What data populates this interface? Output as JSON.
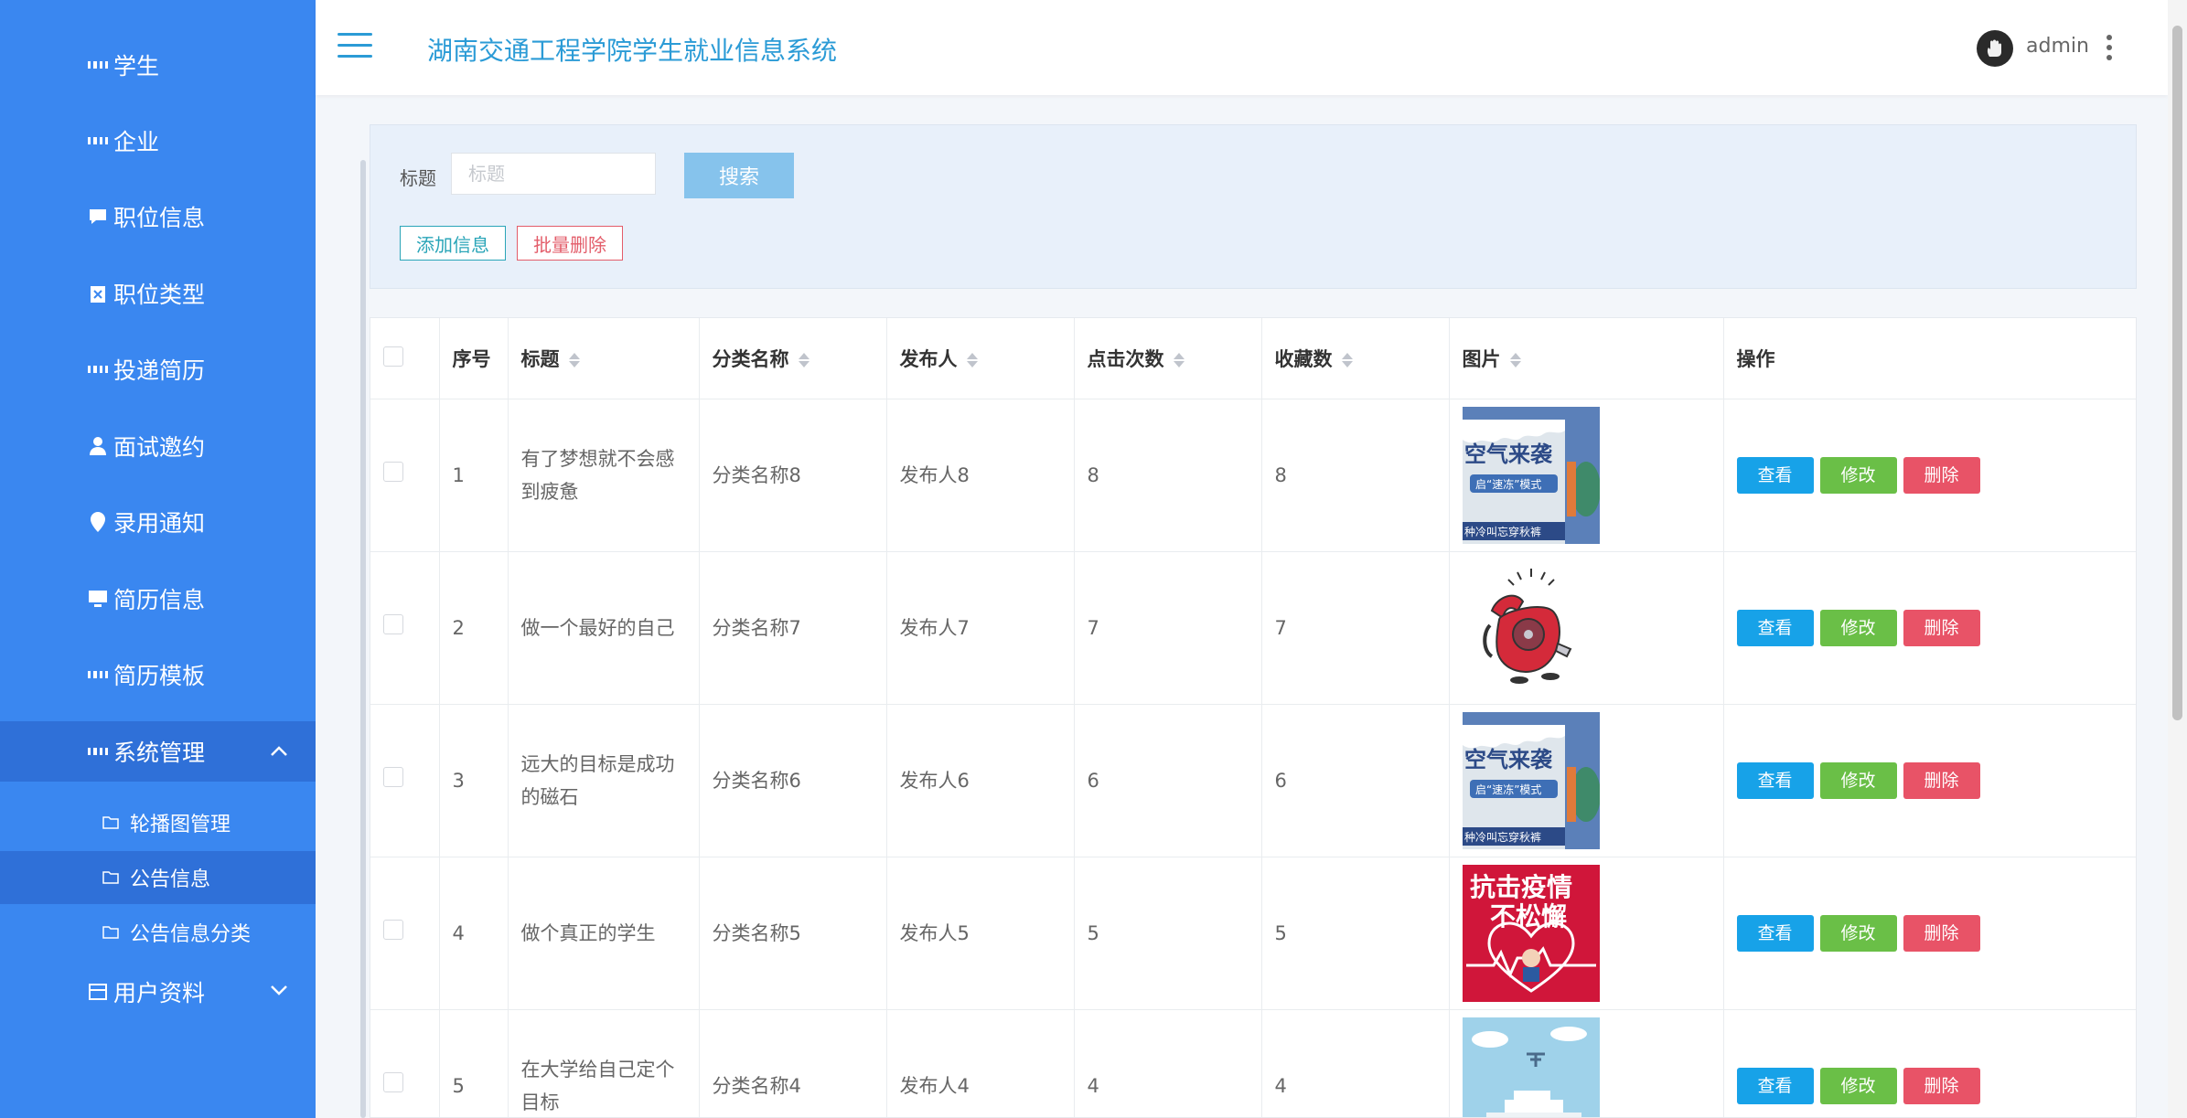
{
  "app": {
    "title": "湖南交通工程学院学生就业信息系统"
  },
  "user": {
    "name": "admin"
  },
  "sidebar": {
    "items": [
      {
        "label": "学生",
        "icon": "grid-icon"
      },
      {
        "label": "企业",
        "icon": "grid-icon"
      },
      {
        "label": "职位信息",
        "icon": "comment-icon"
      },
      {
        "label": "职位类型",
        "icon": "clipboard-icon"
      },
      {
        "label": "投递简历",
        "icon": "grid-icon"
      },
      {
        "label": "面试邀约",
        "icon": "user-icon"
      },
      {
        "label": "录用通知",
        "icon": "map-pin-icon"
      },
      {
        "label": "简历信息",
        "icon": "monitor-icon"
      },
      {
        "label": "简历模板",
        "icon": "grid-icon"
      },
      {
        "label": "系统管理",
        "icon": "grid-icon"
      }
    ],
    "sub_items": [
      {
        "label": "轮播图管理",
        "icon": "folder-icon"
      },
      {
        "label": "公告信息",
        "icon": "folder-icon"
      },
      {
        "label": "公告信息分类",
        "icon": "folder-icon"
      }
    ],
    "last_item": {
      "label": "用户资料",
      "icon": "card-icon"
    }
  },
  "search": {
    "label": "标题",
    "placeholder": "标题",
    "button": "搜索"
  },
  "toolbar": {
    "add_label": "添加信息",
    "batch_delete_label": "批量删除"
  },
  "table": {
    "headers": [
      "序号",
      "标题",
      "分类名称",
      "发布人",
      "点击次数",
      "收藏数",
      "图片",
      "操作"
    ],
    "actions": {
      "view": "查看",
      "edit": "修改",
      "delete": "删除"
    },
    "rows": [
      {
        "no": "1",
        "title": "有了梦想就不会感到疲惫",
        "category": "分类名称8",
        "publisher": "发布人8",
        "clicks": "8",
        "favorites": "8",
        "image": "cold-air-poster"
      },
      {
        "no": "2",
        "title": "做一个最好的自己",
        "category": "分类名称7",
        "publisher": "发布人7",
        "clicks": "7",
        "favorites": "7",
        "image": "red-telephone"
      },
      {
        "no": "3",
        "title": "远大的目标是成功的磁石",
        "category": "分类名称6",
        "publisher": "发布人6",
        "clicks": "6",
        "favorites": "6",
        "image": "cold-air-poster"
      },
      {
        "no": "4",
        "title": "做个真正的学生",
        "category": "分类名称5",
        "publisher": "发布人5",
        "clicks": "5",
        "favorites": "5",
        "image": "fight-epidemic-poster"
      },
      {
        "no": "5",
        "title": "在大学给自己定个目标",
        "category": "分类名称4",
        "publisher": "发布人4",
        "clicks": "4",
        "favorites": "4",
        "image": "ship-illustration"
      }
    ]
  },
  "images": {
    "cold_air": {
      "line1": "空气来袭",
      "line2": "启“速冻”模式",
      "line3": "种冷叫忘穿秋裤"
    },
    "epidemic": {
      "line1": "抗击疫情",
      "line2": "不松懈"
    }
  },
  "colors": {
    "sidebar": "#3a87f0",
    "sidebar_active": "#2f70d8",
    "title": "#2b9bd6",
    "view": "#17a2e8",
    "edit": "#6abf47",
    "delete": "#e85367"
  }
}
